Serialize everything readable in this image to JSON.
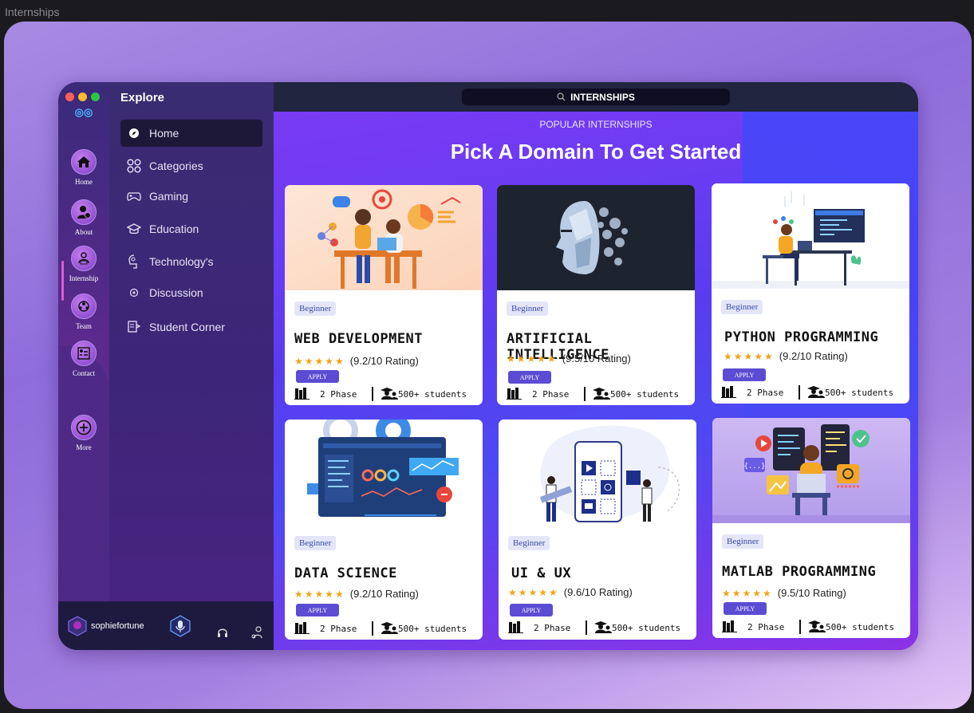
{
  "window": {
    "title": "Internships"
  },
  "rail": {
    "items": [
      {
        "label": "Home",
        "icon": "home-icon"
      },
      {
        "label": "About",
        "icon": "user-info-icon"
      },
      {
        "label": "Internship",
        "icon": "internship-icon"
      },
      {
        "label": "Team",
        "icon": "team-icon"
      },
      {
        "label": "Contact",
        "icon": "contact-icon"
      },
      {
        "label": "More",
        "icon": "plus-icon"
      }
    ],
    "active": "Internship"
  },
  "sidebar": {
    "title": "Explore",
    "items": [
      {
        "label": "Home",
        "icon": "compass-icon"
      },
      {
        "label": "Categories",
        "icon": "categories-icon"
      },
      {
        "label": "Gaming",
        "icon": "gamepad-icon"
      },
      {
        "label": "Education",
        "icon": "graduation-cap-icon"
      },
      {
        "label": "Technology's",
        "icon": "technology-icon"
      },
      {
        "label": "Discussion",
        "icon": "discussion-icon"
      },
      {
        "label": "Student Corner",
        "icon": "student-corner-icon"
      }
    ],
    "active": "Home"
  },
  "user": {
    "name": "sophiefortune"
  },
  "search": {
    "label": "INTERNSHIPS"
  },
  "main": {
    "eyebrow": "POPULAR INTERNSHIPS",
    "headline": "Pick A Domain To Get Started"
  },
  "cards": [
    {
      "level": "Beginner",
      "title": "WEB DEVELOPMENT",
      "rating": "(9.2/10 Rating)",
      "stars": 5,
      "apply": "APPLY",
      "phase": "2 Phase",
      "students": "500+ students"
    },
    {
      "level": "Beginner",
      "title": "ARTIFICIAL INTELLIGENCE",
      "rating": "(9.5/10 Rating)",
      "stars": 5,
      "apply": "APPLY",
      "phase": "2 Phase",
      "students": "500+ students"
    },
    {
      "level": "Beginner",
      "title": "PYTHON PROGRAMMING",
      "rating": "(9.2/10 Rating)",
      "stars": 5,
      "apply": "APPLY",
      "phase": "2 Phase",
      "students": "500+ students"
    },
    {
      "level": "Beginner",
      "title": "DATA SCIENCE",
      "rating": "(9.2/10 Rating)",
      "stars": 5,
      "apply": "APPLY",
      "phase": "2 Phase",
      "students": "500+ students"
    },
    {
      "level": "Beginner",
      "title": "UI & UX",
      "rating": "(9.6/10 Rating)",
      "stars": 5,
      "apply": "APPLY",
      "phase": "2 Phase",
      "students": "500+ students"
    },
    {
      "level": "Beginner",
      "title": "MATLAB PROGRAMMING",
      "rating": "(9.5/10 Rating)",
      "stars": 5,
      "apply": "APPLY",
      "phase": "2 Phase",
      "students": "500+ students"
    }
  ],
  "colors": {
    "accent": "#5b4cd3",
    "star": "#f0a41b",
    "dot_red": "#ff5f57",
    "dot_yellow": "#febc2e",
    "dot_green": "#28c840"
  }
}
